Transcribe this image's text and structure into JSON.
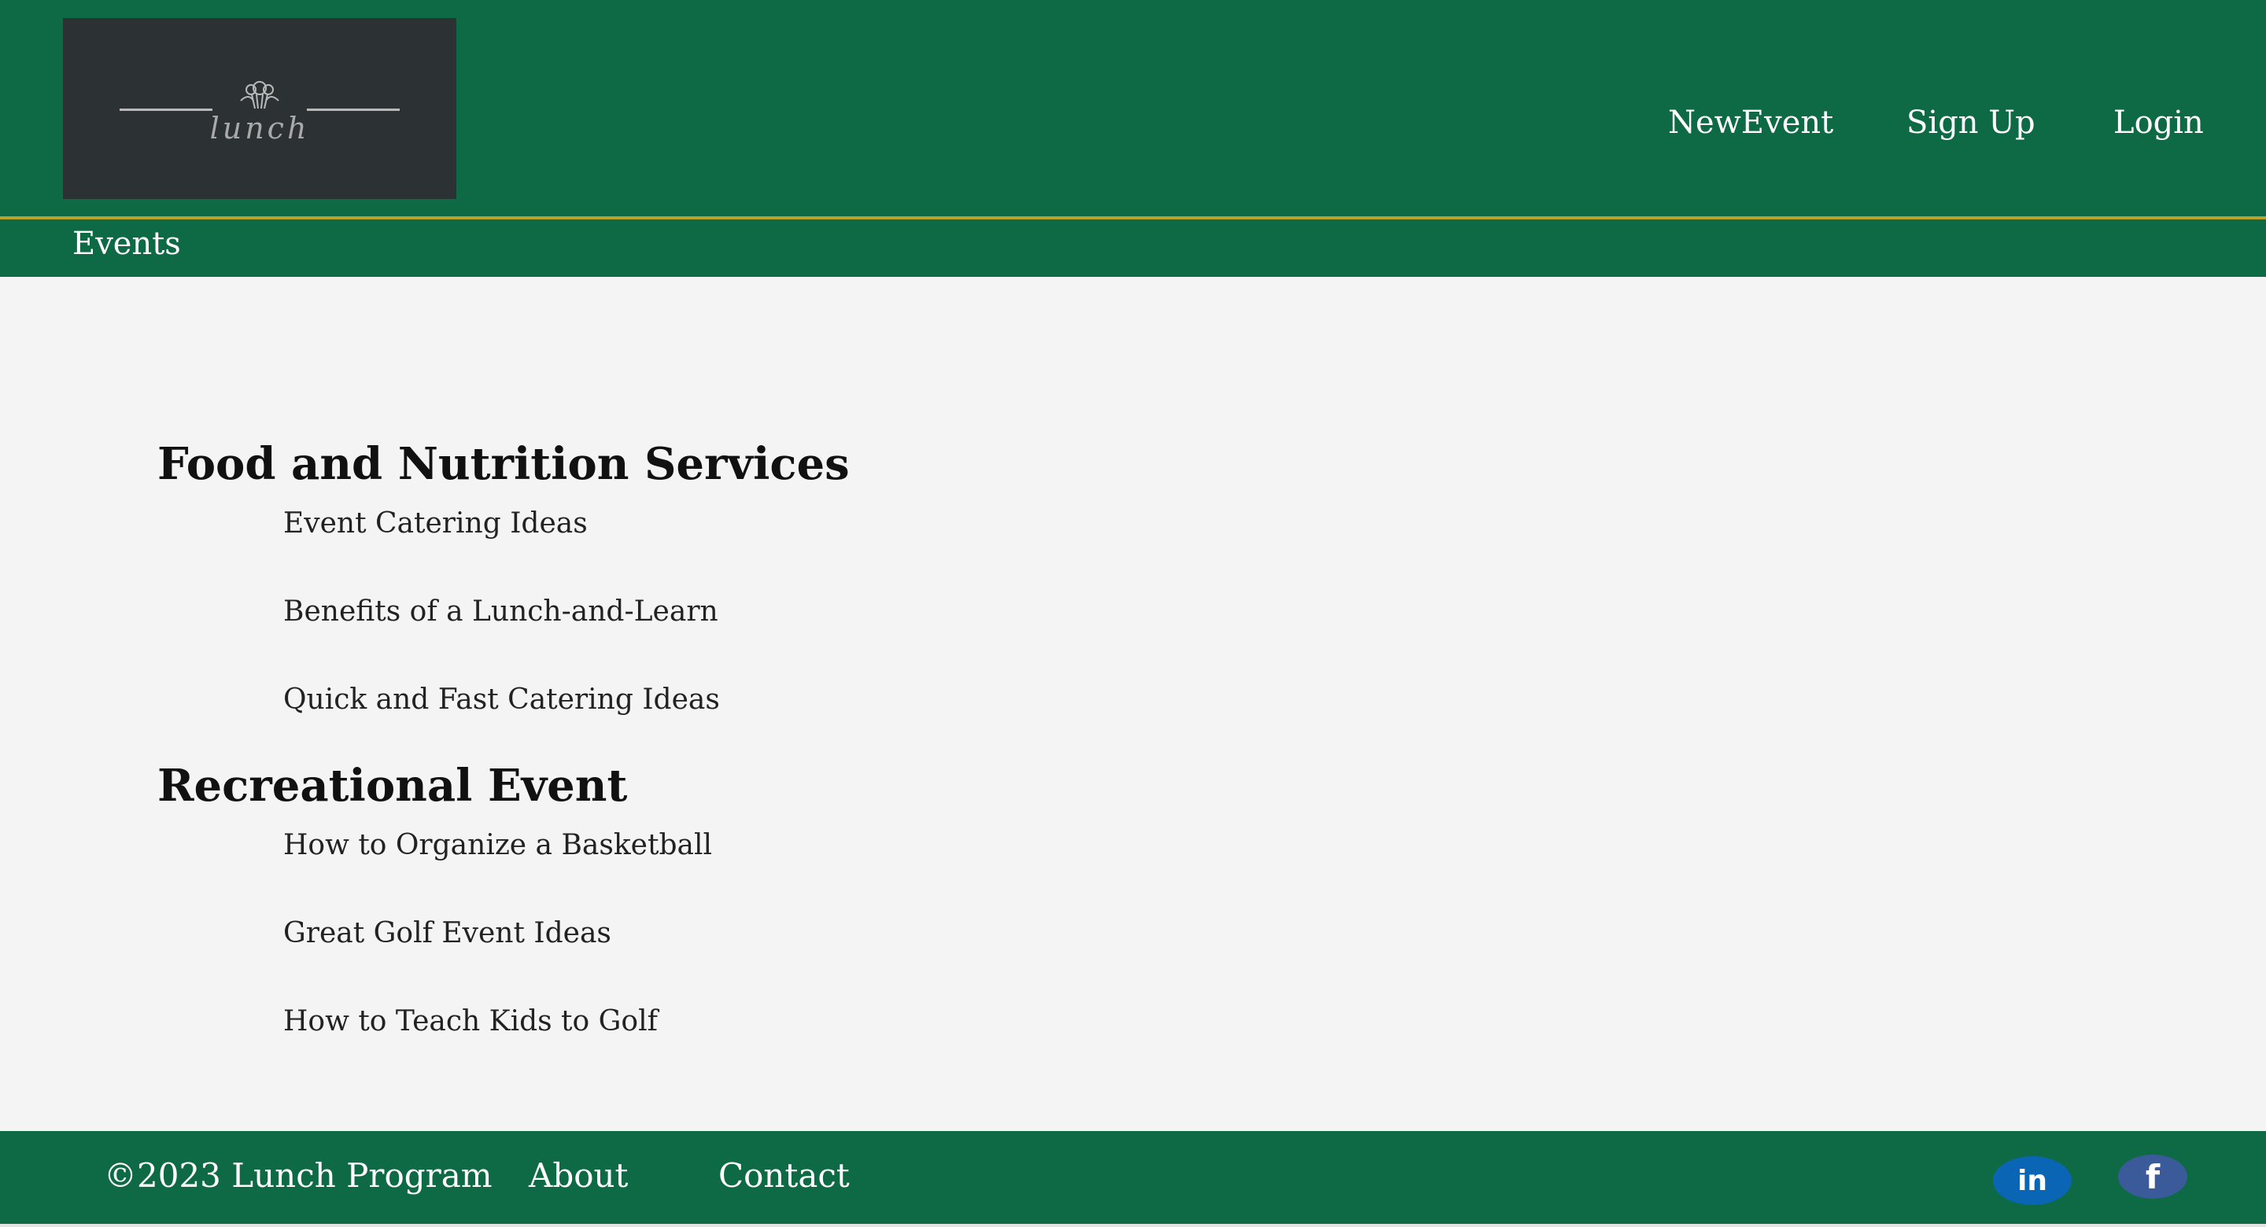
{
  "header": {
    "logo_text": "lunch",
    "nav": [
      "NewEvent",
      "Sign Up",
      "Login"
    ]
  },
  "subbar": {
    "label": "Events"
  },
  "sections": [
    {
      "title": "Food and Nutrition Services",
      "items": [
        "Event Catering Ideas",
        "Benefits of a Lunch-and-Learn",
        "Quick and Fast Catering Ideas"
      ]
    },
    {
      "title": "Recreational Event",
      "items": [
        "How to Organize a Basketball",
        "Great Golf Event Ideas",
        "How to Teach Kids to Golf"
      ]
    }
  ],
  "footer": {
    "copyright": "©2023 Lunch Program",
    "links": [
      "About",
      "Contact"
    ],
    "social": [
      {
        "icon": "linkedin-icon",
        "glyph": "in",
        "color": "#0a66b5"
      },
      {
        "icon": "facebook-icon",
        "glyph": "f",
        "color": "#3b5a9a"
      }
    ]
  },
  "colors": {
    "brand_green": "#0e6a45",
    "accent_gold": "#b8a22b",
    "page_bg": "#f4f4f5"
  }
}
